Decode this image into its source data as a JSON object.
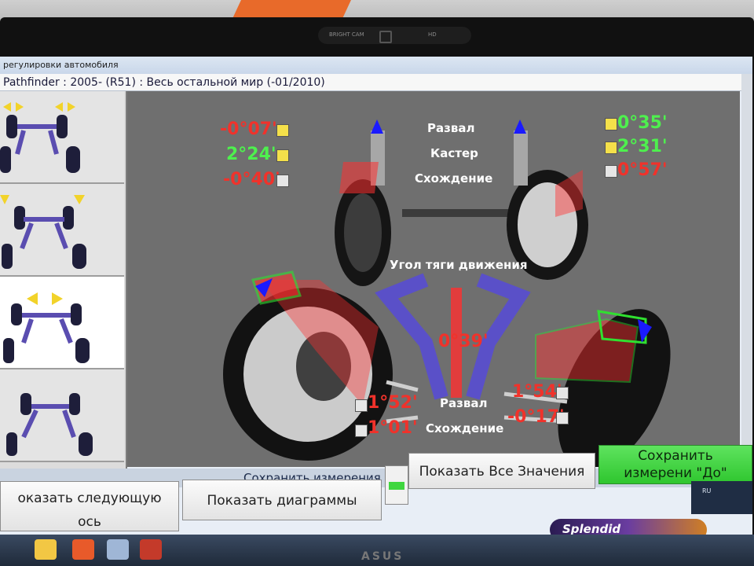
{
  "window": {
    "title": "регулировки автомобиля",
    "vehicle": "Pathfinder : 2005-  (R51) : Весь остальной мир (-01/2010)"
  },
  "camera": {
    "left_label": "BRIGHT CAM",
    "right_label": "HD"
  },
  "front_axle": {
    "left": {
      "camber": "-0°07'",
      "caster": "2°24'",
      "toe": "-0°40'"
    },
    "right": {
      "camber": "0°35'",
      "caster": "2°31'",
      "toe": "0°57'"
    },
    "labels": {
      "camber": "Развал",
      "caster": "Кастер",
      "toe": "Схождение"
    }
  },
  "thrust": {
    "label": "Угол тяги движения",
    "value": "0°39'"
  },
  "rear_axle": {
    "left": {
      "camber": "1°52'",
      "toe": "1°01'"
    },
    "right": {
      "camber": "1°54'",
      "toe": "-0°17'"
    },
    "labels": {
      "camber": "Развал",
      "toe": "Схождение"
    }
  },
  "status": "Сохранить измерения регулировки \"До\".",
  "buttons": {
    "next_axle": "оказать следующую ось",
    "diagrams": "Показать диаграммы",
    "all_values": "Показать Все Значения",
    "save_before": "Сохранить  измерени \"До\""
  },
  "brand": {
    "splendid": "Splendid",
    "monitor": "ASUS"
  },
  "tray": {
    "lang": "RU"
  },
  "colors": {
    "out_of_spec": "#f0322b",
    "in_spec": "#4ef04e",
    "view_bg": "#6f6f6f",
    "save_btn": "#3fd63f"
  }
}
